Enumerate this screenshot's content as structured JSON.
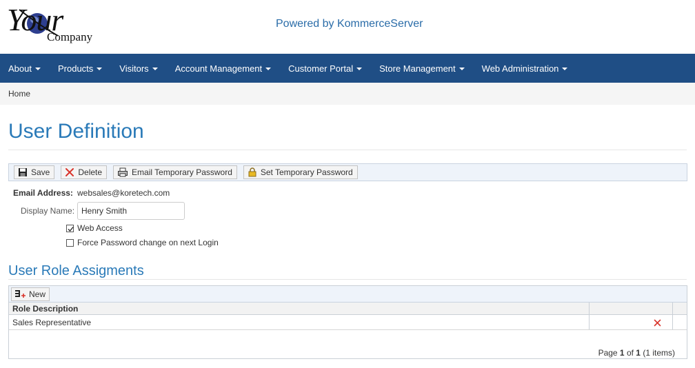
{
  "header": {
    "logo_your": "Your",
    "logo_company": "Company",
    "powered_by": "Powered by KommerceServer"
  },
  "nav": {
    "items": [
      {
        "label": "About"
      },
      {
        "label": "Products"
      },
      {
        "label": "Visitors"
      },
      {
        "label": "Account Management"
      },
      {
        "label": "Customer Portal"
      },
      {
        "label": "Store Management"
      },
      {
        "label": "Web Administration"
      }
    ]
  },
  "breadcrumb": {
    "home": "Home"
  },
  "page": {
    "title": "User Definition"
  },
  "toolbar": {
    "save": "Save",
    "delete": "Delete",
    "email_temp": "Email Temporary Password",
    "set_temp": "Set Temporary Password"
  },
  "form": {
    "email_label": "Email Address:",
    "email_value": "websales@koretech.com",
    "display_label": "Display Name:",
    "display_value": "Henry Smith",
    "web_access_label": "Web Access",
    "web_access_checked": true,
    "force_pw_label": "Force Password change on next Login",
    "force_pw_checked": false
  },
  "roles": {
    "section_title": "User Role Assigments",
    "new_label": "New",
    "column_header": "Role Description",
    "rows": [
      {
        "description": "Sales Representative"
      }
    ],
    "pager": {
      "prefix": "Page ",
      "page": "1",
      "of": " of ",
      "total_pages": "1",
      "items": " (1 items)"
    }
  },
  "colors": {
    "navbar": "#1f4e85",
    "title": "#2a7ab8",
    "delete_red": "#d9342b"
  }
}
